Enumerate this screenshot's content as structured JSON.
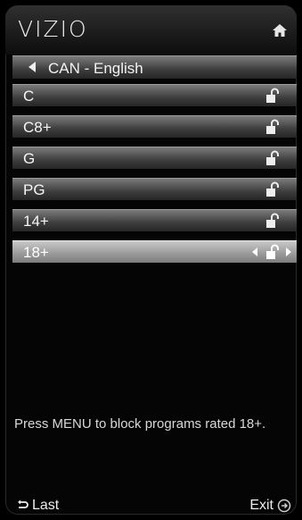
{
  "header": {
    "brand": "VIZIO",
    "home_icon": "home-icon"
  },
  "language": {
    "value": "CAN - English"
  },
  "ratings": [
    {
      "label": "C",
      "status": "unlocked"
    },
    {
      "label": "C8+",
      "status": "unlocked"
    },
    {
      "label": "G",
      "status": "unlocked"
    },
    {
      "label": "PG",
      "status": "unlocked"
    },
    {
      "label": "14+",
      "status": "unlocked"
    },
    {
      "label": "18+",
      "status": "unlocked",
      "selected": true
    }
  ],
  "help": {
    "text": "Press  MENU  to block programs rated 18+."
  },
  "footer": {
    "last_label": "Last",
    "exit_label": "Exit"
  },
  "colors": {
    "background": "#000000",
    "selected_row": "#a9a9a9",
    "row": "#3d3d3d"
  }
}
